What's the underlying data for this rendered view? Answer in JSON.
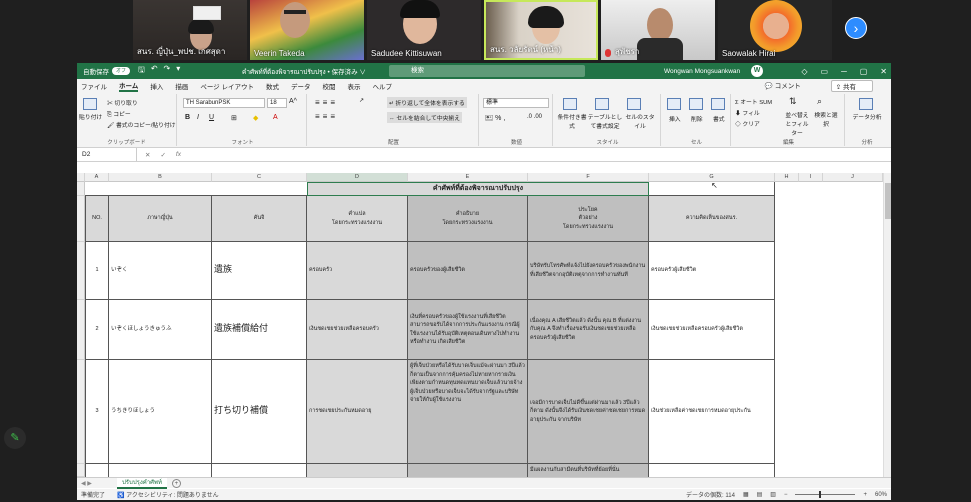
{
  "zoom": {
    "participants": [
      {
        "name": "สนร. ญี่ปุ่น_พปช. เกศสุดา"
      },
      {
        "name": "Veerin Takeda"
      },
      {
        "name": "Sadudee Kittisuwan"
      },
      {
        "name": "สนร. วลัยรัตน์ (หน้า)"
      },
      {
        "name": "สุพัชรา"
      },
      {
        "name": "Saowalak Hirai"
      }
    ],
    "next_icon": "chevron-right-icon"
  },
  "excel": {
    "autosave_label": "自動保存",
    "autosave_state": "オフ",
    "filename": "คำศัพท์ที่ต้องพิจารณาปรับปรุง • 保存済み ∨",
    "search_placeholder": "検索",
    "user": "Wongwan Mongsuankwan",
    "user_initial": "W",
    "tabs": [
      "ファイル",
      "ホーム",
      "挿入",
      "描画",
      "ページ レイアウト",
      "数式",
      "データ",
      "校閲",
      "表示",
      "ヘルプ"
    ],
    "active_tab": "ホーム",
    "comment_label": "コメント",
    "share_label": "共有",
    "ribbon": {
      "clipboard": {
        "paste": "貼り付け",
        "cut": "切り取り",
        "copy": "コピー",
        "format_painter": "書式のコピー/貼り付け",
        "label": "クリップボード"
      },
      "font": {
        "name": "TH SarabunPSK",
        "size": "18",
        "label": "フォント"
      },
      "alignment": {
        "wrap": "折り返して全体を表示する",
        "merge": "セルを結合して中央揃え",
        "label": "配置"
      },
      "number": {
        "format": "標準",
        "label": "数値"
      },
      "styles": {
        "conditional": "条件付き書式",
        "table": "テーブルとして書式設定",
        "cell": "セルのスタイル",
        "label": "スタイル"
      },
      "cells": {
        "insert": "挿入",
        "delete": "削除",
        "format": "書式",
        "label": "セル"
      },
      "editing": {
        "autosum": "オート SUM",
        "fill": "フィル",
        "clear": "クリア",
        "sort": "並べ替えとフィルター",
        "find": "検索と選択",
        "label": "編集"
      },
      "analysis": {
        "analyze": "データ分析",
        "label": "分析"
      }
    },
    "name_box": "D2",
    "columns": [
      "A",
      "B",
      "C",
      "D",
      "E",
      "F",
      "G",
      "H",
      "I",
      "J"
    ],
    "table": {
      "title": "คำศัพท์ที่ต้องพิจารณาปรับปรุง",
      "headers": {
        "no": "NO.",
        "jp": "ภาษาญี่ปุ่น",
        "kanji": "คันจิ",
        "d_line1": "คำแปล",
        "d_line2": "โดยกระทรวงแรงงาน",
        "e_line1": "คำอธิบาย",
        "e_line2": "โดยกระทรวงแรงงาน",
        "f_line1": "ประโยค",
        "f_line2": "ตัวอย่าง",
        "f_line3": "โดยกระทรวงแรงงาน",
        "g": "ความคิดเห็นของสนร."
      },
      "rows": [
        {
          "no": "1",
          "reading": "いぞく",
          "kanji": "遺族",
          "translation": "ครอบครัว",
          "explanation": "ครอบครัวของผู้เสียชีวิต",
          "example": "บริษัทรับโทรศัพท์แจ้งไปยังครอบครัวของพนักงานที่เสียชีวิตจากอุบัติเหตุจากการทำงานทันที",
          "comment": "ครอบครัวผู้เสียชีวิต"
        },
        {
          "no": "2",
          "reading": "いぞくほしょうきゅうふ",
          "kanji": "遺族補償給付",
          "translation": "เงินชดเชยช่วยเหลือครอบครัว",
          "explanation": "เงินที่ครอบครัวของผู้ใช้แรงงานที่เสียชีวิตสามารถขอรับได้จากการประกันแรงงาน กรณีผู้ใช้แรงงานได้รับอุบัติเหตุตอนเดินทางไปทำงานหรือทำงาน เกิดเสียชีวิต",
          "example": "เนื่องคุณ A เสียชีวิตแล้ว ดังนั้น คุณ B ที่แต่งงานกับคุณ A จึงทำเรื่องขอรับเงินชดเชยช่วยเหลือครอบครัวผู้เสียชีวิต",
          "comment": "เงินชดเชยช่วยเหลือครอบครัวผู้เสียชีวิต"
        },
        {
          "no": "3",
          "reading": "うちきりほしょう",
          "kanji": "打ち切り補償",
          "translation": "การชดเชยประกันหมดอายุ",
          "explanation": "ผู้ที่เจ็บป่วยหรือได้รับบาดเจ็บแม้จะผ่านมา 3ปีแล้วก็ตามเป็นจากการคุ้มครองไม่หายหากรายเงินเพียงตามกำหนดทุนทดแทนบาดเจ็บแล้วนายจ้างผู้เจ็บป่วยหรือบาดเจ็บจะได้รับจากรัฐและบริษัทจ่ายให้กับผู้ใช้แรงงาน",
          "example": "เจอมีการบาดเจ็บไม่ดีขึ้นแต่ผ่านมาแล้ว 3ปีแล้วก็ตาม ดังนั้นจึงได้รับเงินชดเชยค่าชดเชยการหมดอายุประกัน จากบริษัท",
          "comment": "เงินช่วยเหลือค่าชดเชยการหมดอายุประกัน"
        },
        {
          "no": "",
          "reading": "",
          "kanji": "",
          "translation": "",
          "explanation": "",
          "example": "มีแผลงานกับสามีตนที่บริษัทที่ย้อยที่นั่น",
          "comment": ""
        }
      ]
    },
    "sheet_tab": "ปรับปรุงคำศัพท์",
    "status": {
      "ready": "準備完了",
      "accessibility": "アクセシビリティ: 問題ありません",
      "count_label": "データの個数: 114",
      "zoom": "60%"
    }
  }
}
